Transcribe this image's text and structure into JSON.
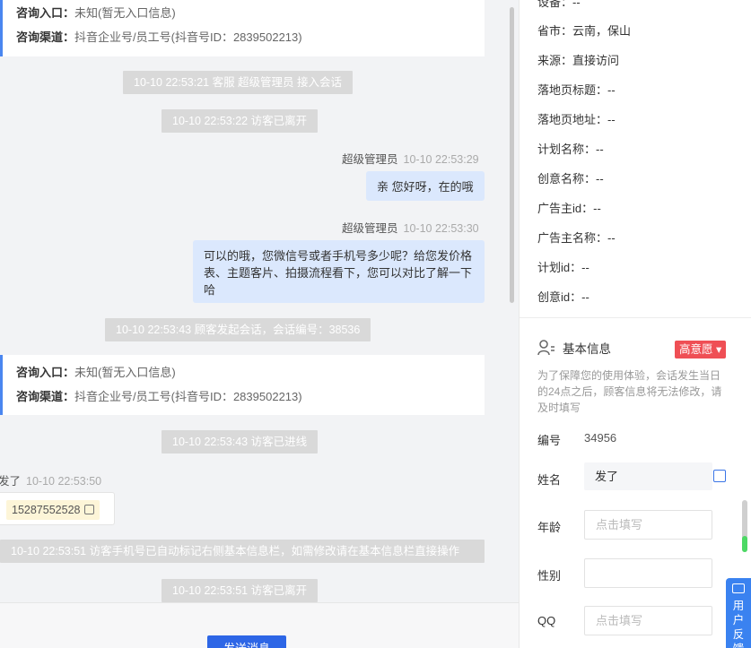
{
  "chat": {
    "card1": {
      "entry_label": "咨询入口：",
      "entry_value": "未知(暂无入口信息)",
      "channel_label": "咨询渠道：",
      "channel_value": "抖音企业号/员工号(抖音号ID：2839502213)"
    },
    "sys1": "10-10 22:53:21 客服 超级管理员 接入会话",
    "sys2": "10-10 22:53:22 访客已离开",
    "msg1": {
      "sender": "超级管理员",
      "time": "10-10 22:53:29",
      "text": "亲 您好呀，在的哦"
    },
    "msg2": {
      "sender": "超级管理员",
      "time": "10-10 22:53:30",
      "text": "可以的哦，您微信号或者手机号多少呢？给您发价格表、主题客片、拍摄流程看下，您可以对比了解一下哈"
    },
    "sys3": "10-10 22:53:43 顾客发起会话，会话编号：38536",
    "card2": {
      "entry_label": "咨询入口：",
      "entry_value": "未知(暂无入口信息)",
      "channel_label": "咨询渠道：",
      "channel_value": "抖音企业号/员工号(抖音号ID：2839502213)"
    },
    "sys4": "10-10 22:53:43 访客已进线",
    "msg3": {
      "sender": "发了",
      "time": "10-10 22:53:50",
      "phone": "15287552528"
    },
    "sys5": "10-10 22:53:51 访客手机号已自动标记右侧基本信息栏，如需修改请在基本信息栏直接操作",
    "sys6": "10-10 22:53:51 访客已离开",
    "send_label": "发送消息"
  },
  "right": {
    "device": "设备：--",
    "region": "省市：云南，保山",
    "source": "来源：直接访问",
    "landing_title": "落地页标题：--",
    "landing_url": "落地页地址：--",
    "plan_name": "计划名称：--",
    "creative_name": "创意名称：--",
    "advertiser_id": "广告主id：--",
    "advertiser_name": "广告主名称：--",
    "plan_id": "计划id：--",
    "creative_id": "创意id：--",
    "basic_title": "基本信息",
    "intent_badge": "高意愿",
    "tip": "为了保障您的使用体验，会话发生当日的24点之后，顾客信息将无法修改，请及时填写",
    "id_label": "编号",
    "id_value": "34956",
    "name_label": "姓名",
    "name_value": "发了",
    "age_label": "年龄",
    "age_placeholder": "点击填写",
    "gender_label": "性别",
    "qq_label": "QQ",
    "qq_placeholder": "点击填写"
  },
  "feedback_label": "用户反馈",
  "colors": {
    "accent": "#2d66e6",
    "badge": "#ef4f55",
    "bubble_out": "#dbe8fd",
    "feedback": "#3a82f0"
  }
}
